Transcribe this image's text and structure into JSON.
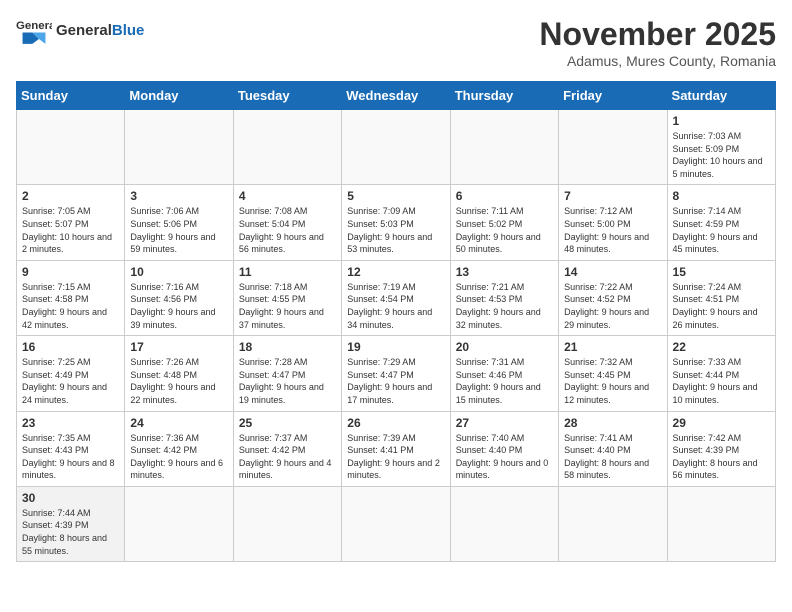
{
  "logo": {
    "text_general": "General",
    "text_blue": "Blue"
  },
  "header": {
    "month": "November 2025",
    "location": "Adamus, Mures County, Romania"
  },
  "days_of_week": [
    "Sunday",
    "Monday",
    "Tuesday",
    "Wednesday",
    "Thursday",
    "Friday",
    "Saturday"
  ],
  "weeks": [
    [
      {
        "day": "",
        "info": ""
      },
      {
        "day": "",
        "info": ""
      },
      {
        "day": "",
        "info": ""
      },
      {
        "day": "",
        "info": ""
      },
      {
        "day": "",
        "info": ""
      },
      {
        "day": "",
        "info": ""
      },
      {
        "day": "1",
        "info": "Sunrise: 7:03 AM\nSunset: 5:09 PM\nDaylight: 10 hours and 5 minutes."
      }
    ],
    [
      {
        "day": "2",
        "info": "Sunrise: 7:05 AM\nSunset: 5:07 PM\nDaylight: 10 hours and 2 minutes."
      },
      {
        "day": "3",
        "info": "Sunrise: 7:06 AM\nSunset: 5:06 PM\nDaylight: 9 hours and 59 minutes."
      },
      {
        "day": "4",
        "info": "Sunrise: 7:08 AM\nSunset: 5:04 PM\nDaylight: 9 hours and 56 minutes."
      },
      {
        "day": "5",
        "info": "Sunrise: 7:09 AM\nSunset: 5:03 PM\nDaylight: 9 hours and 53 minutes."
      },
      {
        "day": "6",
        "info": "Sunrise: 7:11 AM\nSunset: 5:02 PM\nDaylight: 9 hours and 50 minutes."
      },
      {
        "day": "7",
        "info": "Sunrise: 7:12 AM\nSunset: 5:00 PM\nDaylight: 9 hours and 48 minutes."
      },
      {
        "day": "8",
        "info": "Sunrise: 7:14 AM\nSunset: 4:59 PM\nDaylight: 9 hours and 45 minutes."
      }
    ],
    [
      {
        "day": "9",
        "info": "Sunrise: 7:15 AM\nSunset: 4:58 PM\nDaylight: 9 hours and 42 minutes."
      },
      {
        "day": "10",
        "info": "Sunrise: 7:16 AM\nSunset: 4:56 PM\nDaylight: 9 hours and 39 minutes."
      },
      {
        "day": "11",
        "info": "Sunrise: 7:18 AM\nSunset: 4:55 PM\nDaylight: 9 hours and 37 minutes."
      },
      {
        "day": "12",
        "info": "Sunrise: 7:19 AM\nSunset: 4:54 PM\nDaylight: 9 hours and 34 minutes."
      },
      {
        "day": "13",
        "info": "Sunrise: 7:21 AM\nSunset: 4:53 PM\nDaylight: 9 hours and 32 minutes."
      },
      {
        "day": "14",
        "info": "Sunrise: 7:22 AM\nSunset: 4:52 PM\nDaylight: 9 hours and 29 minutes."
      },
      {
        "day": "15",
        "info": "Sunrise: 7:24 AM\nSunset: 4:51 PM\nDaylight: 9 hours and 26 minutes."
      }
    ],
    [
      {
        "day": "16",
        "info": "Sunrise: 7:25 AM\nSunset: 4:49 PM\nDaylight: 9 hours and 24 minutes."
      },
      {
        "day": "17",
        "info": "Sunrise: 7:26 AM\nSunset: 4:48 PM\nDaylight: 9 hours and 22 minutes."
      },
      {
        "day": "18",
        "info": "Sunrise: 7:28 AM\nSunset: 4:47 PM\nDaylight: 9 hours and 19 minutes."
      },
      {
        "day": "19",
        "info": "Sunrise: 7:29 AM\nSunset: 4:47 PM\nDaylight: 9 hours and 17 minutes."
      },
      {
        "day": "20",
        "info": "Sunrise: 7:31 AM\nSunset: 4:46 PM\nDaylight: 9 hours and 15 minutes."
      },
      {
        "day": "21",
        "info": "Sunrise: 7:32 AM\nSunset: 4:45 PM\nDaylight: 9 hours and 12 minutes."
      },
      {
        "day": "22",
        "info": "Sunrise: 7:33 AM\nSunset: 4:44 PM\nDaylight: 9 hours and 10 minutes."
      }
    ],
    [
      {
        "day": "23",
        "info": "Sunrise: 7:35 AM\nSunset: 4:43 PM\nDaylight: 9 hours and 8 minutes."
      },
      {
        "day": "24",
        "info": "Sunrise: 7:36 AM\nSunset: 4:42 PM\nDaylight: 9 hours and 6 minutes."
      },
      {
        "day": "25",
        "info": "Sunrise: 7:37 AM\nSunset: 4:42 PM\nDaylight: 9 hours and 4 minutes."
      },
      {
        "day": "26",
        "info": "Sunrise: 7:39 AM\nSunset: 4:41 PM\nDaylight: 9 hours and 2 minutes."
      },
      {
        "day": "27",
        "info": "Sunrise: 7:40 AM\nSunset: 4:40 PM\nDaylight: 9 hours and 0 minutes."
      },
      {
        "day": "28",
        "info": "Sunrise: 7:41 AM\nSunset: 4:40 PM\nDaylight: 8 hours and 58 minutes."
      },
      {
        "day": "29",
        "info": "Sunrise: 7:42 AM\nSunset: 4:39 PM\nDaylight: 8 hours and 56 minutes."
      }
    ],
    [
      {
        "day": "30",
        "info": "Sunrise: 7:44 AM\nSunset: 4:39 PM\nDaylight: 8 hours and 55 minutes."
      },
      {
        "day": "",
        "info": ""
      },
      {
        "day": "",
        "info": ""
      },
      {
        "day": "",
        "info": ""
      },
      {
        "day": "",
        "info": ""
      },
      {
        "day": "",
        "info": ""
      },
      {
        "day": "",
        "info": ""
      }
    ]
  ]
}
